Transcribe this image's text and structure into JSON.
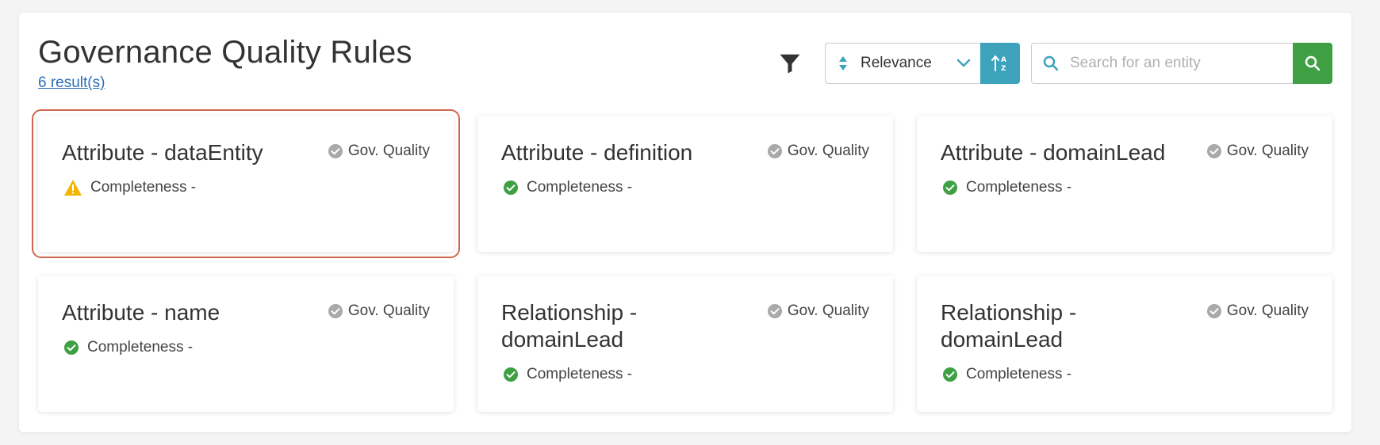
{
  "page": {
    "title": "Governance Quality Rules",
    "result_count": "6 result(s)"
  },
  "toolbar": {
    "filter_icon": "filter-icon",
    "sort_label": "Relevance",
    "search_placeholder": "Search for an entity",
    "search_value": ""
  },
  "colors": {
    "accent_teal": "#3da3bd",
    "search_green": "#3ea043",
    "link_blue": "#2a6ebb",
    "status_ok": "#3ea043",
    "status_warn": "#f2b600",
    "tag_gray": "#a9a9a9",
    "selection_outline": "#d0664a"
  },
  "cards": [
    {
      "title": "Attribute - dataEntity",
      "tag": "Gov. Quality",
      "status": "warning",
      "status_text": "Completeness -"
    },
    {
      "title": "Attribute - definition",
      "tag": "Gov. Quality",
      "status": "ok",
      "status_text": "Completeness -"
    },
    {
      "title": "Attribute - domainLead",
      "tag": "Gov. Quality",
      "status": "ok",
      "status_text": "Completeness -"
    },
    {
      "title": "Attribute - name",
      "tag": "Gov. Quality",
      "status": "ok",
      "status_text": "Completeness -"
    },
    {
      "title": "Relationship - domainLead",
      "tag": "Gov. Quality",
      "status": "ok",
      "status_text": "Completeness -"
    },
    {
      "title": "Relationship - domainLead",
      "tag": "Gov. Quality",
      "status": "ok",
      "status_text": "Completeness -"
    }
  ]
}
